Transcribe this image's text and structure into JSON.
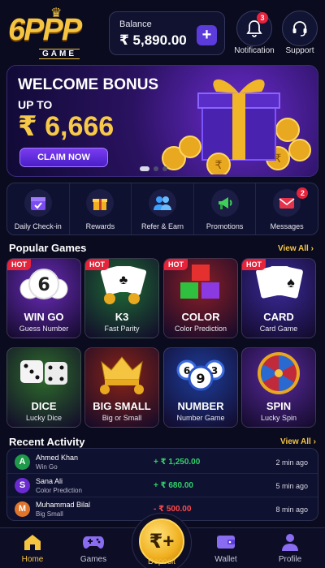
{
  "header": {
    "logo_text": "6PPP",
    "logo_sub": "GAME",
    "balance_label": "Balance",
    "balance_amount": "₹ 5,890.00",
    "notification_label": "Notification",
    "notification_count": "3",
    "support_label": "Support"
  },
  "banner": {
    "title": "WELCOME BONUS",
    "subtitle": "UP TO",
    "amount": "₹ 6,666",
    "button": "CLAIM NOW"
  },
  "quick_actions": [
    {
      "label": "Daily Check-in",
      "icon": "calendar-check-icon"
    },
    {
      "label": "Rewards",
      "icon": "gift-icon"
    },
    {
      "label": "Refer & Earn",
      "icon": "users-icon"
    },
    {
      "label": "Promotions",
      "icon": "megaphone-icon"
    },
    {
      "label": "Messages",
      "icon": "mail-icon",
      "badge": "2"
    }
  ],
  "popular": {
    "title": "Popular Games",
    "view_all": "View All ›",
    "games": [
      {
        "name": "WIN GO",
        "sub": "Guess Number",
        "hot": "HOT",
        "color": "#6a2bb8"
      },
      {
        "name": "K3",
        "sub": "Fast Parity",
        "hot": "HOT",
        "color": "#1e6a34"
      },
      {
        "name": "COLOR",
        "sub": "Color Prediction",
        "hot": "HOT",
        "color": "#8a1f26"
      },
      {
        "name": "CARD",
        "sub": "Card Game",
        "hot": "HOT",
        "color": "#3b2a9a"
      },
      {
        "name": "DICE",
        "sub": "Lucky Dice",
        "color": "#2e6d2a"
      },
      {
        "name": "BIG SMALL",
        "sub": "Big or Small",
        "color": "#8a2416"
      },
      {
        "name": "NUMBER",
        "sub": "Number Game",
        "color": "#1d3d9a"
      },
      {
        "name": "SPIN",
        "sub": "Lucky Spin",
        "color": "#5a2a9e"
      }
    ]
  },
  "recent": {
    "title": "Recent Activity",
    "view_all": "View All ›",
    "rows": [
      {
        "initial": "A",
        "name": "Ahmed Khan",
        "game": "Win Go",
        "amount": "+ ₹ 1,250.00",
        "time": "2 min ago",
        "avatar_color": "#1e9a4a",
        "amount_color": "#2fd36a"
      },
      {
        "initial": "S",
        "name": "Sana Ali",
        "game": "Color Prediction",
        "amount": "+ ₹ 680.00",
        "time": "5 min ago",
        "avatar_color": "#6a2bd0",
        "amount_color": "#2fd36a"
      },
      {
        "initial": "M",
        "name": "Muhammad Bilal",
        "game": "Big Small",
        "amount": "- ₹ 500.00",
        "time": "8 min ago",
        "avatar_color": "#e0742a",
        "amount_color": "#ff4a4a"
      }
    ]
  },
  "nav": {
    "home": "Home",
    "games": "Games",
    "deposit": "Deposit",
    "wallet": "Wallet",
    "profile": "Profile"
  },
  "colors": {
    "accent": "#f5c542",
    "purple": "#5b3bd9",
    "hot": "#e5233b"
  }
}
